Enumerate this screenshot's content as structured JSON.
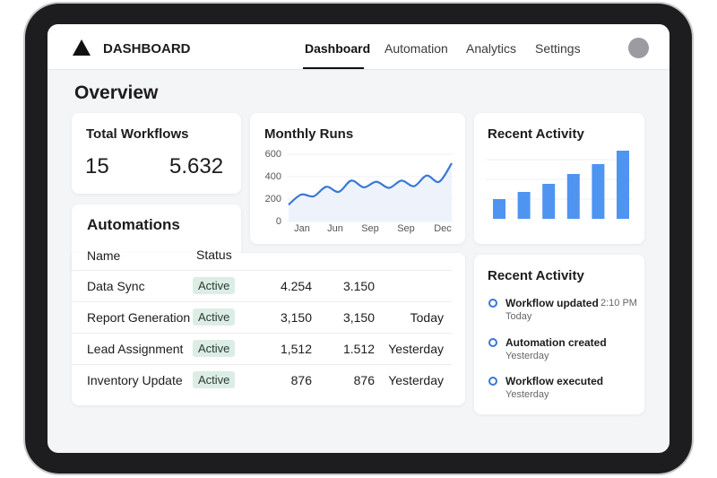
{
  "header": {
    "logo_text": "DASHBOARD",
    "nav": [
      "Dashboard",
      "Automation",
      "Analytics",
      "Settings"
    ],
    "active_nav": "Dashboard"
  },
  "page_title": "Overview",
  "total_workflows": {
    "title": "Total Workflows",
    "value1": "15",
    "value2": "5.632"
  },
  "monthly_runs": {
    "title": "Monthly Runs"
  },
  "recent_activity_chart": {
    "title": "Recent Activity"
  },
  "automations": {
    "title": "Automations",
    "columns": [
      "Name",
      "Status"
    ],
    "rows": [
      {
        "name": "Data Sync",
        "status": "Active",
        "v1": "4.254",
        "v2": "3.150",
        "when": ""
      },
      {
        "name": "Report Generation",
        "status": "Active",
        "v1": "3,150",
        "v2": "3,150",
        "when": "Today"
      },
      {
        "name": "Lead Assignment",
        "status": "Active",
        "v1": "1,512",
        "v2": "1.512",
        "when": "Yesterday"
      },
      {
        "name": "Inventory Update",
        "status": "Active",
        "v1": "876",
        "v2": "876",
        "when": "Yesterday"
      }
    ]
  },
  "recent_activity": {
    "title": "Recent Activity",
    "items": [
      {
        "title": "Workflow updated",
        "time": "2:10 PM",
        "sub": "Today"
      },
      {
        "title": "Automation created",
        "time": "",
        "sub": "Yesterday"
      },
      {
        "title": "Workflow executed",
        "time": "",
        "sub": "Yesterday"
      }
    ]
  },
  "chart_data": [
    {
      "type": "area",
      "title": "Monthly Runs",
      "ylim": [
        0,
        600
      ],
      "yticks": [
        "600",
        "400",
        "200",
        "0"
      ],
      "xtick_labels": [
        "Jan",
        "Jun",
        "Sep",
        "Sep",
        "Dec"
      ],
      "values": [
        150,
        240,
        225,
        310,
        265,
        365,
        305,
        355,
        300,
        365,
        315,
        410,
        355,
        520
      ],
      "color": "#3a78d4",
      "grid": true
    },
    {
      "type": "bar",
      "title": "Recent Activity",
      "values": [
        22,
        30,
        39,
        50,
        61,
        76
      ],
      "color": "#4f94f0",
      "grid": true
    }
  ]
}
